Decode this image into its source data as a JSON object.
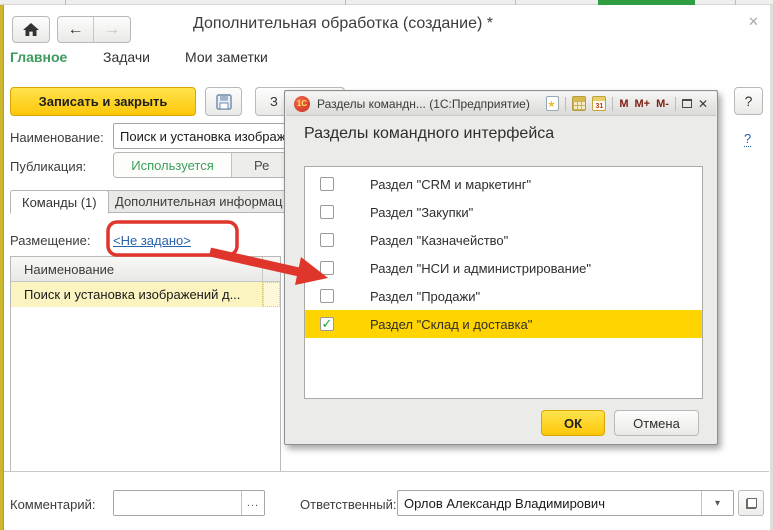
{
  "colors": {
    "accent_yellow": "#fdc708",
    "highlight_row_yellow": "#ffd400",
    "pale_row_yellow": "#fcf4c0",
    "green_menu": "#3a9b5c",
    "green_status": "#3aa05a",
    "tab_strip_green": "#2f9e43",
    "link_blue": "#2a63ad",
    "annotation_red": "#e0352b"
  },
  "window": {
    "title": "Дополнительная обработка (создание) *",
    "close_icon": "✕"
  },
  "menu": {
    "items": [
      {
        "label": "Главное",
        "active": true
      },
      {
        "label": "Задачи",
        "active": false
      },
      {
        "label": "Мои заметки",
        "active": false
      }
    ]
  },
  "toolbar": {
    "save_close": "Записать и закрыть",
    "save_partial": "З",
    "help": "?",
    "help_link": "?"
  },
  "nav": {
    "back": "←",
    "forward": "→"
  },
  "fields": {
    "name": {
      "label": "Наименование:",
      "value": "Поиск и установка изображ"
    },
    "publication": {
      "label": "Публикация:",
      "segments": [
        {
          "label": "Используется",
          "active": true
        },
        {
          "label": "Ре",
          "active": false
        }
      ]
    },
    "placement": {
      "label": "Размещение:",
      "link": "<Не задано>"
    },
    "comment": {
      "label": "Комментарий:",
      "value": "",
      "more": "..."
    },
    "responsible": {
      "label": "Ответственный:",
      "value": "Орлов Александр Владимирович",
      "dropdown": "▾"
    }
  },
  "tabs": [
    {
      "label": "Команды (1)",
      "active": true
    },
    {
      "label": "Дополнительная информац",
      "active": false
    }
  ],
  "table": {
    "header": "Наименование",
    "rows": [
      {
        "name": "Поиск и установка изображений д..."
      }
    ]
  },
  "dialog": {
    "titlebar": {
      "logo": "1С",
      "title": "Разделы командн... (1С:Предприятие)",
      "memory_buttons": [
        "M",
        "M+",
        "M-"
      ],
      "star_icon": "★",
      "calendar_day": "31",
      "close_icon": "✕"
    },
    "heading": "Разделы командного интерфейса",
    "items": [
      {
        "label": "Раздел \"CRM и маркетинг\"",
        "checked": false
      },
      {
        "label": "Раздел \"Закупки\"",
        "checked": false
      },
      {
        "label": "Раздел \"Казначейство\"",
        "checked": false
      },
      {
        "label": "Раздел \"НСИ и администрирование\"",
        "checked": false
      },
      {
        "label": "Раздел \"Продажи\"",
        "checked": false
      },
      {
        "label": "Раздел \"Склад и доставка\"",
        "checked": true
      }
    ],
    "buttons": {
      "ok": "ОК",
      "cancel": "Отмена"
    },
    "check_glyph": "✓"
  }
}
